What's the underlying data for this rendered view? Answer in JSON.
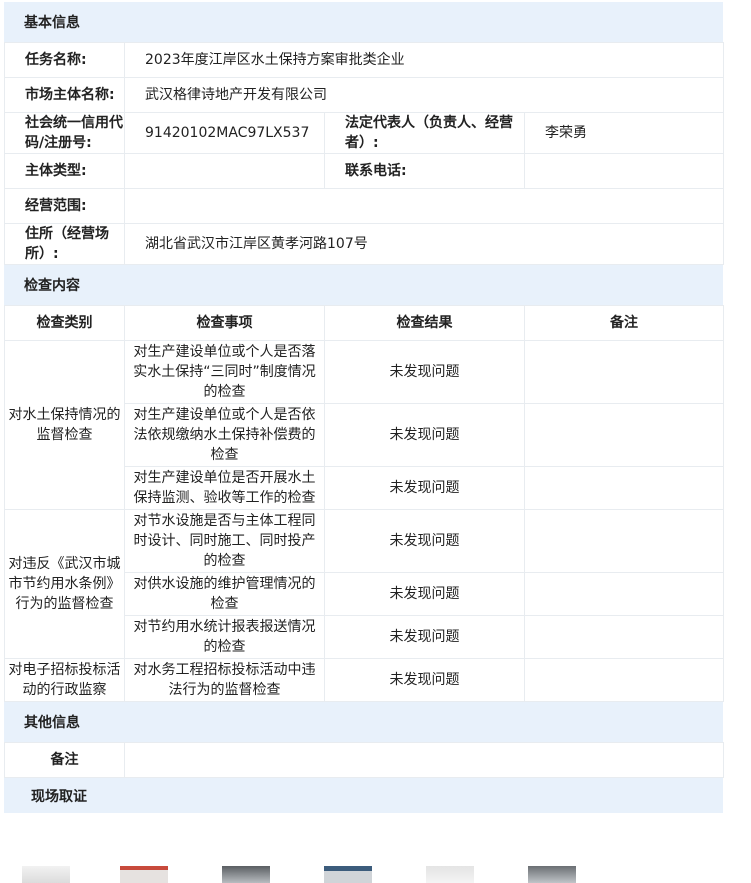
{
  "sections": {
    "basic": "基本信息",
    "inspection": "检查内容",
    "other": "其他信息",
    "evidence": "现场取证"
  },
  "basic_info": {
    "task_name_label": "任务名称:",
    "task_name": "2023年度江岸区水土保持方案审批类企业",
    "entity_name_label": "市场主体名称:",
    "entity_name": "武汉格律诗地产开发有限公司",
    "credit_code_label": "社会统一信用代码/注册号:",
    "credit_code": "91420102MAC97LX537",
    "legal_rep_label": "法定代表人（负责人、经营者）:",
    "legal_rep": "李荣勇",
    "entity_type_label": "主体类型:",
    "entity_type": "",
    "phone_label": "联系电话:",
    "phone": "",
    "scope_label": "经营范围:",
    "scope": "",
    "address_label": "住所（经营场所）:",
    "address": "湖北省武汉市江岸区黄孝河路107号"
  },
  "inspection": {
    "headers": [
      "检查类别",
      "检查事项",
      "检查结果",
      "备注"
    ],
    "groups": [
      {
        "category": "对水土保持情况的监督检查",
        "items": [
          {
            "item": "对生产建设单位或个人是否落实水土保持“三同时”制度情况的检查",
            "result": "未发现问题",
            "note": ""
          },
          {
            "item": "对生产建设单位或个人是否依法依规缴纳水土保持补偿费的检查",
            "result": "未发现问题",
            "note": ""
          },
          {
            "item": "对生产建设单位是否开展水土保持监测、验收等工作的检查",
            "result": "未发现问题",
            "note": ""
          }
        ]
      },
      {
        "category": "对违反《武汉市城市节约用水条例》行为的监督检查",
        "items": [
          {
            "item": "对节水设施是否与主体工程同时设计、同时施工、同时投产的检查",
            "result": "未发现问题",
            "note": ""
          },
          {
            "item": "对供水设施的维护管理情况的检查",
            "result": "未发现问题",
            "note": ""
          },
          {
            "item": "对节约用水统计报表报送情况的检查",
            "result": "未发现问题",
            "note": ""
          }
        ]
      },
      {
        "category": "对电子招标投标活动的行政监察",
        "items": [
          {
            "item": "对水务工程招标投标活动中违法行为的监督检查",
            "result": "未发现问题",
            "note": ""
          }
        ]
      }
    ]
  },
  "other_info": {
    "note_label": "备注",
    "note": ""
  },
  "colors": {
    "section_bg": "#e8f1fb",
    "border": "#e8ecf0"
  }
}
